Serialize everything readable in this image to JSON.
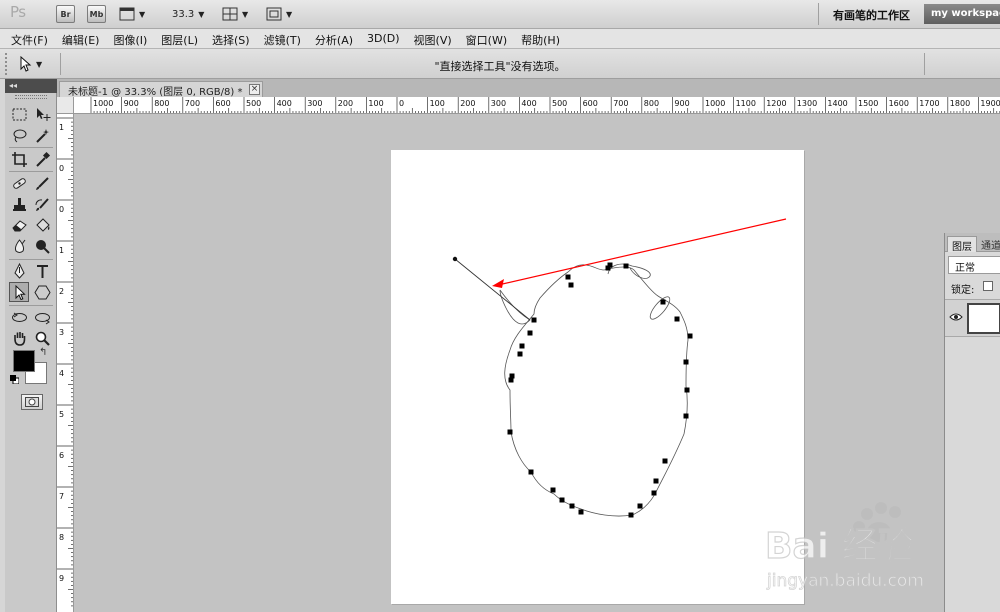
{
  "app": {
    "logo": "Ps",
    "bridge_label": "Br",
    "minibridge_label": "Mb",
    "zoom": "33.3",
    "workspace_title": "有画笔的工作区",
    "workspace_button": "my workspace"
  },
  "menu": [
    "文件(F)",
    "编辑(E)",
    "图像(I)",
    "图层(L)",
    "选择(S)",
    "滤镜(T)",
    "分析(A)",
    "3D(D)",
    "视图(V)",
    "窗口(W)",
    "帮助(H)"
  ],
  "options_bar": {
    "message": "\"直接选择工具\"没有选项。"
  },
  "toolbox": {
    "header": "◂◂",
    "tools": [
      "marquee-tool",
      "move-tool",
      "lasso-tool",
      "magic-wand-tool",
      "crop-tool",
      "eyedropper-tool",
      "healing-brush-tool",
      "brush-tool",
      "clone-stamp-tool",
      "history-brush-tool",
      "eraser-tool",
      "paint-bucket-tool",
      "blur-tool",
      "dodge-tool",
      "pen-tool",
      "type-tool",
      "direct-selection-tool",
      "shape-tool",
      "3d-rotate-tool",
      "3d-orbit-tool",
      "hand-tool",
      "zoom-tool"
    ],
    "active_tool": "direct-selection-tool",
    "foreground_color": "#000000",
    "background_color": "#ffffff"
  },
  "document": {
    "tab_title": "未标题-1 @ 33.3% (图层 0, RGB/8) *",
    "close_label": "×"
  },
  "rulers": {
    "top_labels": [
      "1000",
      "900",
      "800",
      "700",
      "600",
      "500",
      "400",
      "300",
      "200",
      "100",
      "0",
      "100",
      "200",
      "300",
      "400",
      "500",
      "600",
      "700",
      "800",
      "900",
      "1000",
      "1100",
      "1200",
      "1300",
      "1400",
      "1500",
      "1600",
      "1700",
      "1800",
      "1900"
    ],
    "left_labels": [
      "1",
      "0",
      "0",
      "1",
      "2",
      "3",
      "4",
      "5",
      "6",
      "7",
      "8",
      "9"
    ]
  },
  "layers_panel": {
    "tab_layers": "图层",
    "tab_channels": "通道",
    "blend_mode": "正常",
    "lock_label": "锁定:"
  },
  "watermark": {
    "logo": "Bai 经验",
    "url": "jingyan.baidu.com"
  },
  "colors": {
    "annotation_arrow": "#ff0000",
    "path_stroke": "#555555",
    "anchor": "#000000"
  }
}
